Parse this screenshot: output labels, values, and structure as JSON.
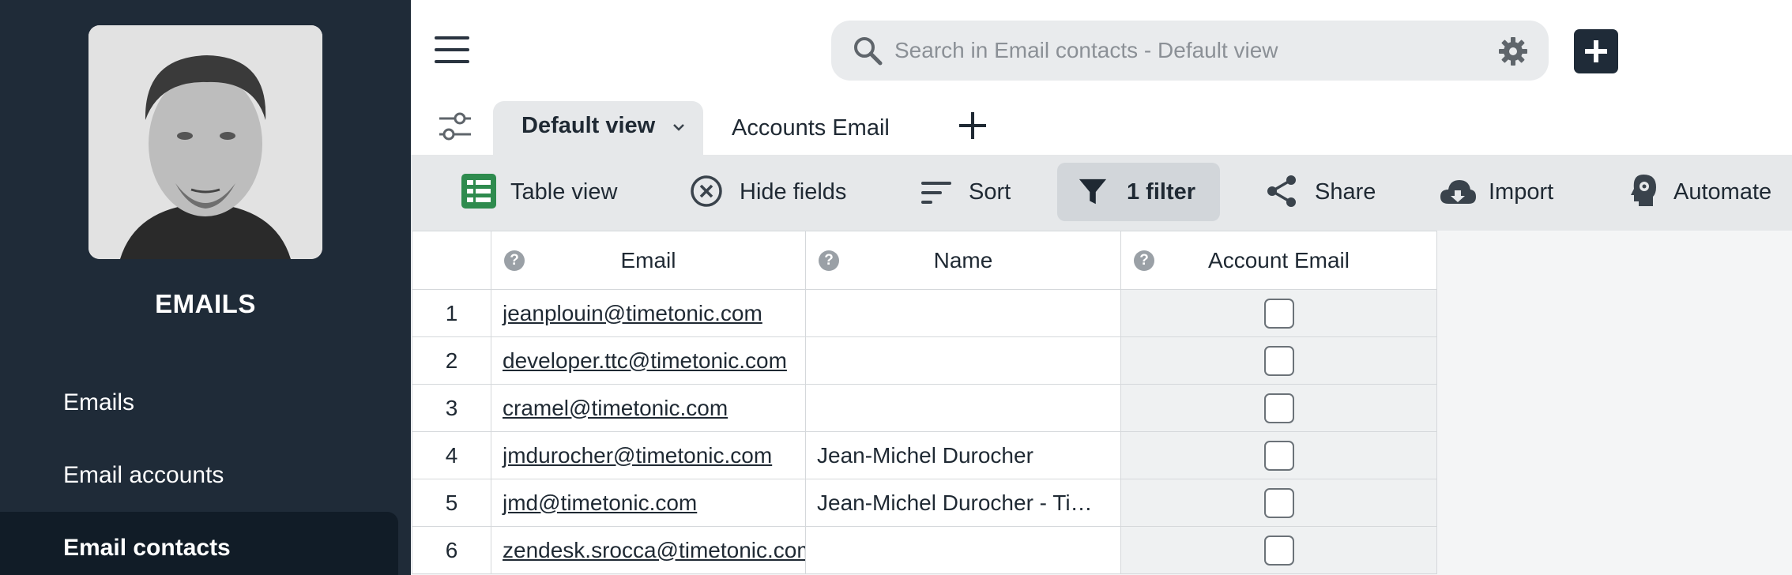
{
  "sidebar": {
    "title": "EMAILS",
    "items": [
      {
        "label": "Emails",
        "active": false
      },
      {
        "label": "Email accounts",
        "active": false
      },
      {
        "label": "Email contacts",
        "active": true
      }
    ]
  },
  "search": {
    "placeholder": "Search in Email contacts - Default view"
  },
  "views": {
    "tabs": [
      {
        "label": "Default view",
        "active": true
      },
      {
        "label": "Accounts Email",
        "active": false
      }
    ]
  },
  "toolbar": {
    "table_view": "Table view",
    "hide_fields": "Hide fields",
    "sort": "Sort",
    "filter": "1 filter",
    "share": "Share",
    "import": "Import",
    "automate": "Automate"
  },
  "table": {
    "help_glyph": "?",
    "columns": [
      "Email",
      "Name",
      "Account Email"
    ],
    "rows": [
      {
        "num": "1",
        "email": "jeanplouin@timetonic.com",
        "name": "",
        "account_email": false
      },
      {
        "num": "2",
        "email": "developer.ttc@timetonic.com",
        "name": "",
        "account_email": false
      },
      {
        "num": "3",
        "email": "cramel@timetonic.com",
        "name": "",
        "account_email": false
      },
      {
        "num": "4",
        "email": "jmdurocher@timetonic.com",
        "name": "Jean-Michel Durocher",
        "account_email": false
      },
      {
        "num": "5",
        "email": "jmd@timetonic.com",
        "name": "Jean-Michel Durocher - Ti…",
        "account_email": false
      },
      {
        "num": "6",
        "email": "zendesk.srocca@timetonic.com",
        "name": "",
        "account_email": false
      }
    ]
  },
  "colors": {
    "sidebar_bg": "#1f2b38",
    "sidebar_active": "#111c27",
    "toolbar_bg": "#e6e8ea",
    "accent_green": "#2e8b4e"
  }
}
